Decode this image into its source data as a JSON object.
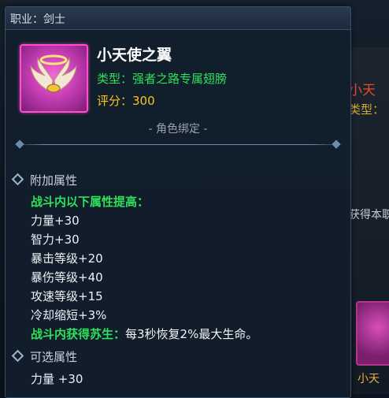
{
  "tooltip": {
    "job": "职业：剑士",
    "item": {
      "name": "小天使之翼",
      "type": "类型：强者之路专属翅膀",
      "score": "评分：300",
      "icon": "angel-wings-icon"
    },
    "binding": "- 角色绑定 -",
    "sections": {
      "bonus": {
        "title": "附加属性",
        "combat_header": "战斗内以下属性提高：",
        "stats": [
          "力量+30",
          "智力+30",
          "暴击等级+20",
          "暴伤等级+40",
          "攻速等级+15",
          "冷却缩短+3%"
        ],
        "revive_label": "战斗内获得苏生：",
        "revive_desc": "每3秒恢复2%最大生命。"
      },
      "optional": {
        "title": "可选属性",
        "stats": [
          "力量 +30"
        ]
      }
    }
  },
  "background": {
    "fragment_1": "小天",
    "fragment_2": "类型：",
    "fragment_3": "获得本职",
    "fragment_4": "小天"
  },
  "colors": {
    "green": "#2ee05a",
    "gold": "#f7c321",
    "magenta_frame": "#ff4fd0",
    "panel": "#121e2c"
  }
}
